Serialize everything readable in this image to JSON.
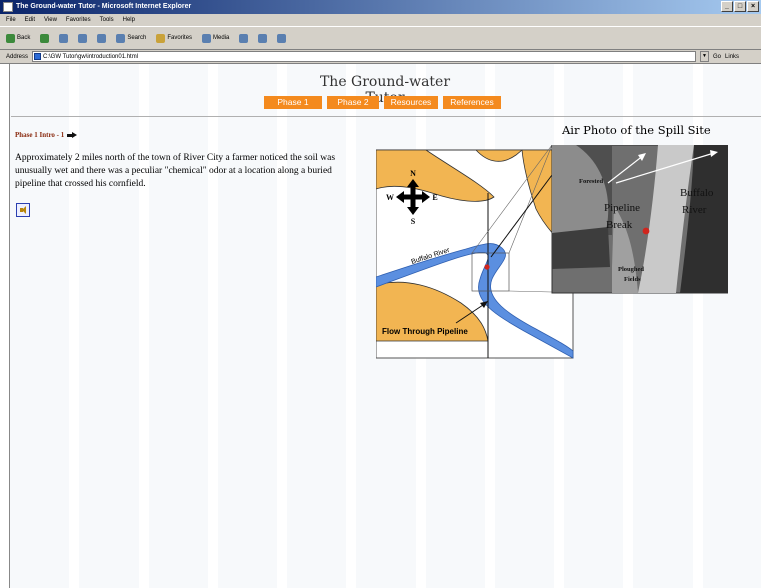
{
  "window": {
    "title": "The Ground-water Tutor - Microsoft Internet Explorer"
  },
  "menu": [
    "File",
    "Edit",
    "View",
    "Favorites",
    "Tools",
    "Help"
  ],
  "toolbar": {
    "back": "Back",
    "search": "Search",
    "favorites": "Favorites",
    "media": "Media"
  },
  "address": {
    "label": "Address",
    "url": "C:\\GW Tutor\\gw\\introduction01.html",
    "go": "Go",
    "links": "Links"
  },
  "site": {
    "title": "The Ground-water Tutor",
    "nav": [
      "Phase 1",
      "Phase 2",
      "Resources",
      "References"
    ]
  },
  "breadcrumb": "Phase 1 Intro - 1",
  "intro": "Approximately 2 miles north of the town of River City a farmer noticed the soil was unusually wet and there was a peculiar \"chemical\" odor at a location along a buried pipeline that crossed his cornfield.",
  "figure": {
    "title": "Air Photo of the Spill Site",
    "compass": {
      "n": "N",
      "s": "S",
      "e": "E",
      "w": "W"
    },
    "river_label": "Buffalo River",
    "pipeline_label": "Flow Through Pipeline",
    "photo_labels": {
      "forested": "Forested",
      "buffalo": "Buffalo",
      "river": "River",
      "pipeline": "Pipeline",
      "break": "Break",
      "ploughed": "Ploughed",
      "fields": "Fields"
    }
  },
  "colors": {
    "nav_bg": "#f48a1e",
    "breadcrumb": "#8a2b10",
    "river": "#5b8fe0",
    "sand": "#f2b552"
  }
}
